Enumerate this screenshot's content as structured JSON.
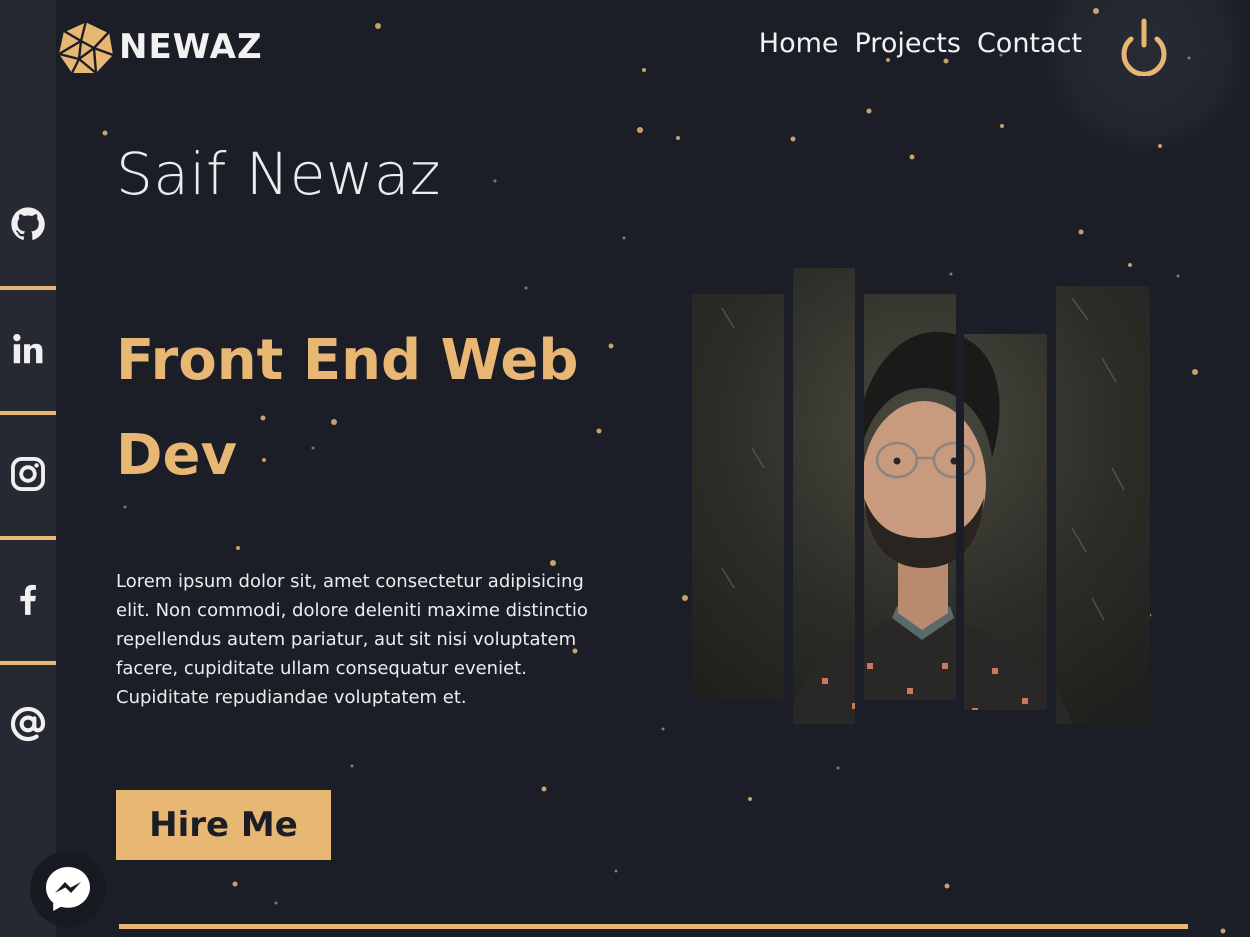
{
  "brand": {
    "name": "NEWAZ",
    "logo_icon": "geodesic-logo-icon",
    "accent": "#e8b773"
  },
  "nav": {
    "items": [
      "Home",
      "Projects",
      "Contact"
    ],
    "power_icon": "power-icon"
  },
  "social": [
    {
      "name": "github",
      "icon": "github-icon"
    },
    {
      "name": "linkedin",
      "icon": "linkedin-icon"
    },
    {
      "name": "instagram",
      "icon": "instagram-icon"
    },
    {
      "name": "facebook",
      "icon": "facebook-icon"
    },
    {
      "name": "email",
      "icon": "at-icon"
    }
  ],
  "hero": {
    "name": "Saif Newaz",
    "role_line1": "Front End Web",
    "role_line2": "Dev",
    "bio": "Lorem ipsum dolor sit, amet consectetur adipisicing elit. Non commodi, dolore deleniti maxime distinctio repellendus autem pariatur, aut sit nisi voluptatem facere, cupiditate ullam consequatur eveniet. Cupiditate repudiandae voluptatem et.",
    "cta": "Hire Me"
  },
  "chat": {
    "icon": "messenger-icon"
  },
  "colors": {
    "background": "#1b1e27",
    "sidebar": "#262932",
    "text": "#ececec",
    "accent": "#e8b773"
  }
}
